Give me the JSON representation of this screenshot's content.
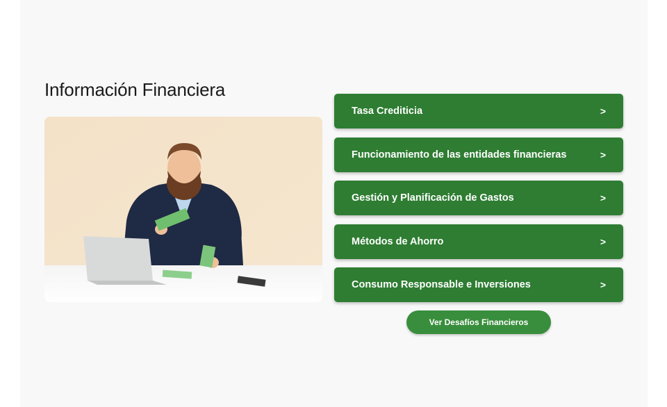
{
  "section": {
    "title": "Información Financiera"
  },
  "menu": {
    "items": [
      {
        "label": "Tasa Crediticia",
        "chevron": ">"
      },
      {
        "label": "Funcionamiento de las entidades financieras",
        "chevron": ">"
      },
      {
        "label": "Gestión y Planificación de Gastos",
        "chevron": ">"
      },
      {
        "label": "Métodos de Ahorro",
        "chevron": ">"
      },
      {
        "label": "Consumo Responsable e Inversiones",
        "chevron": ">"
      }
    ]
  },
  "cta": {
    "label": "Ver Desafíos Financieros"
  },
  "colors": {
    "accent": "#2e7d32",
    "cta": "#388e3c",
    "panel_bg": "#f8f8f8"
  }
}
